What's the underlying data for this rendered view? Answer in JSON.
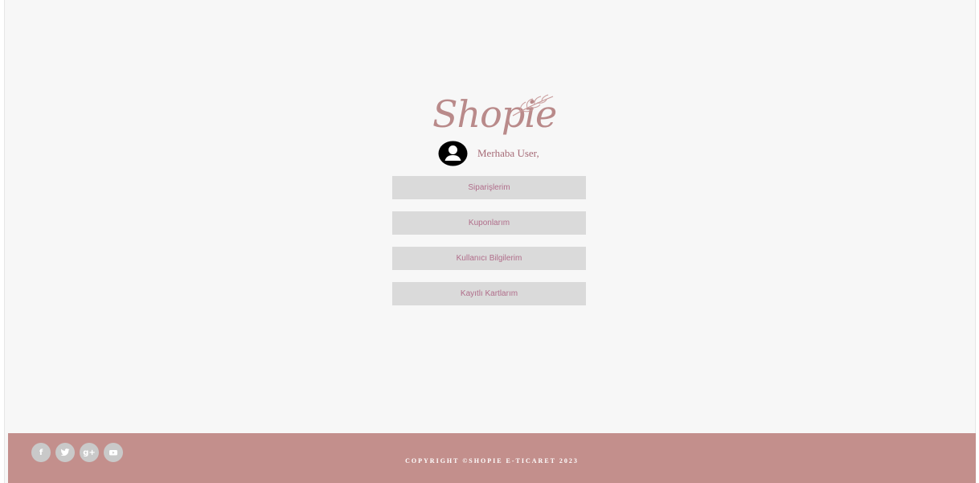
{
  "brand": {
    "logo_text": "Shopie"
  },
  "greeting": {
    "text": "Merhaba User,"
  },
  "menu": {
    "items": [
      {
        "label": "Siparişlerim"
      },
      {
        "label": "Kuponlarım"
      },
      {
        "label": "Kullanıcı Bilgilerim"
      },
      {
        "label": "Kayıtlı Kartlarım"
      }
    ]
  },
  "footer": {
    "social": [
      {
        "icon": "facebook-icon",
        "glyph": "f"
      },
      {
        "icon": "twitter-icon",
        "glyph": "t"
      },
      {
        "icon": "google-plus-icon",
        "glyph": "g+"
      },
      {
        "icon": "youtube-icon",
        "glyph": "▶"
      }
    ],
    "copyright": "COPYRIGHT ©SHOPIE E-TICARET 2023"
  },
  "colors": {
    "page_bg": "#f7f7f7",
    "brand_rose": "#b98a8a",
    "button_bg": "#dadada",
    "button_text": "#b06d8a",
    "footer_bg": "#c38f8c"
  }
}
